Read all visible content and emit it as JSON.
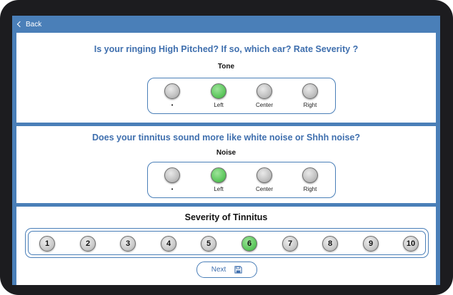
{
  "nav": {
    "back_label": "Back"
  },
  "tone": {
    "question": "Is your ringing High Pitched?  If so, which ear?  Rate Severity ?",
    "label": "Tone",
    "options": [
      "•",
      "Left",
      "Center",
      "Right"
    ],
    "selected": 1
  },
  "noise": {
    "question": "Does your tinnitus sound more like white noise or Shhh noise?",
    "label": "Noise",
    "options": [
      "•",
      "Left",
      "Center",
      "Right"
    ],
    "selected": 1
  },
  "severity": {
    "title": "Severity of Tinnitus",
    "values": [
      "1",
      "2",
      "3",
      "4",
      "5",
      "6",
      "7",
      "8",
      "9",
      "10"
    ],
    "selected": 5
  },
  "footer": {
    "next_label": "Next",
    "next_icon": "save-icon"
  },
  "colors": {
    "accent": "#4a7fb8",
    "selected": "#5fc85f",
    "question_text": "#3f6fae"
  }
}
